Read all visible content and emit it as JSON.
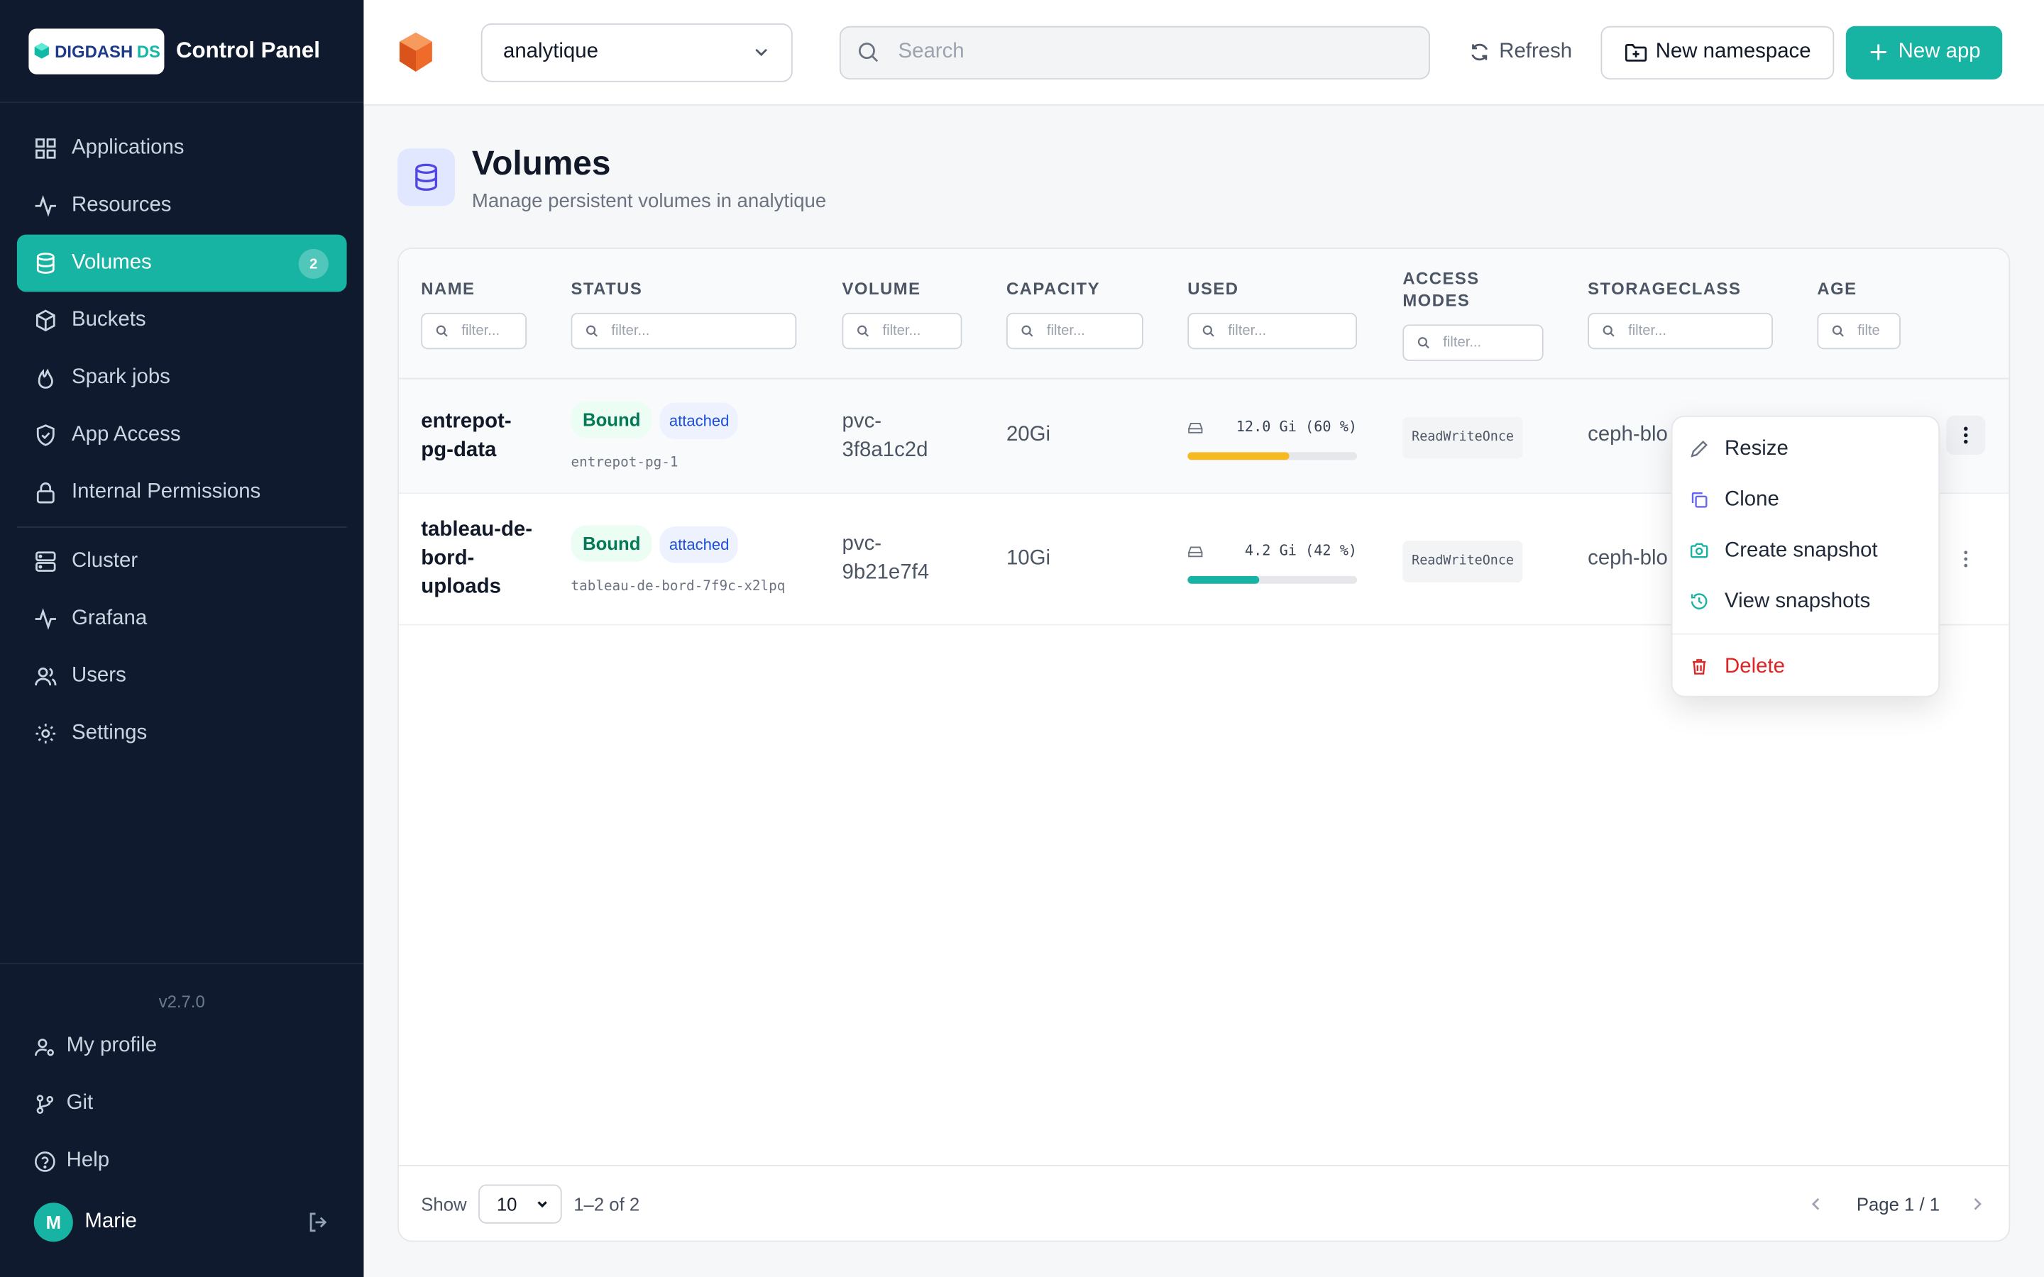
{
  "brand": {
    "logo_main": "DIGDASH",
    "logo_accent": "DS",
    "title": "Control Panel"
  },
  "sidebar": {
    "items": [
      {
        "label": "Applications"
      },
      {
        "label": "Resources"
      },
      {
        "label": "Volumes",
        "badge": "2"
      },
      {
        "label": "Buckets"
      },
      {
        "label": "Spark jobs"
      },
      {
        "label": "App Access"
      },
      {
        "label": "Internal Permissions"
      },
      {
        "label": "Cluster"
      },
      {
        "label": "Grafana"
      },
      {
        "label": "Users"
      },
      {
        "label": "Settings"
      }
    ],
    "version": "v2.7.0",
    "bottom": [
      {
        "label": "My profile"
      },
      {
        "label": "Git"
      },
      {
        "label": "Help"
      }
    ],
    "user": {
      "initial": "M",
      "name": "Marie"
    }
  },
  "topbar": {
    "namespace": "analytique",
    "search_placeholder": "Search",
    "refresh_label": "Refresh",
    "new_namespace_label": "New namespace",
    "new_app_label": "New app"
  },
  "page": {
    "title": "Volumes",
    "subtitle": "Manage persistent volumes in analytique"
  },
  "table": {
    "columns": [
      {
        "label": "NAME"
      },
      {
        "label": "STATUS"
      },
      {
        "label": "VOLUME"
      },
      {
        "label": "CAPACITY"
      },
      {
        "label": "USED"
      },
      {
        "label": "ACCESS MODES"
      },
      {
        "label": "STORAGECLASS"
      },
      {
        "label": "AGE"
      }
    ],
    "filter_placeholder": "filter...",
    "age_filter_placeholder": "filte",
    "rows": [
      {
        "name": "entrepot-pg-data",
        "status": "Bound",
        "attach": "attached",
        "pod": "entrepot-pg-1",
        "volume": "pvc-3f8a1c2d",
        "capacity": "20Gi",
        "used": "12.0 Gi (60 %)",
        "used_pct": 60,
        "bar_color": "#f5b921",
        "access": "ReadWriteOnce",
        "storageclass": "ceph-blo"
      },
      {
        "name": "tableau-de-bord-uploads",
        "status": "Bound",
        "attach": "attached",
        "pod": "tableau-de-bord-7f9c-x2lpq",
        "volume": "pvc-9b21e7f4",
        "capacity": "10Gi",
        "used": "4.2 Gi (42 %)",
        "used_pct": 42,
        "bar_color": "#17b3a3",
        "access": "ReadWriteOnce",
        "storageclass": "ceph-blo"
      }
    ]
  },
  "footer": {
    "show_label": "Show",
    "page_size": "10",
    "range": "1–2 of 2",
    "page": "Page 1 / 1"
  },
  "context_menu": {
    "resize": "Resize",
    "clone": "Clone",
    "create_snapshot": "Create snapshot",
    "view_snapshots": "View snapshots",
    "delete": "Delete"
  },
  "colors": {
    "accent": "#17b3a3",
    "sidebar_bg": "#0f1a2e",
    "danger": "#dc2626",
    "warning": "#f5b921"
  }
}
